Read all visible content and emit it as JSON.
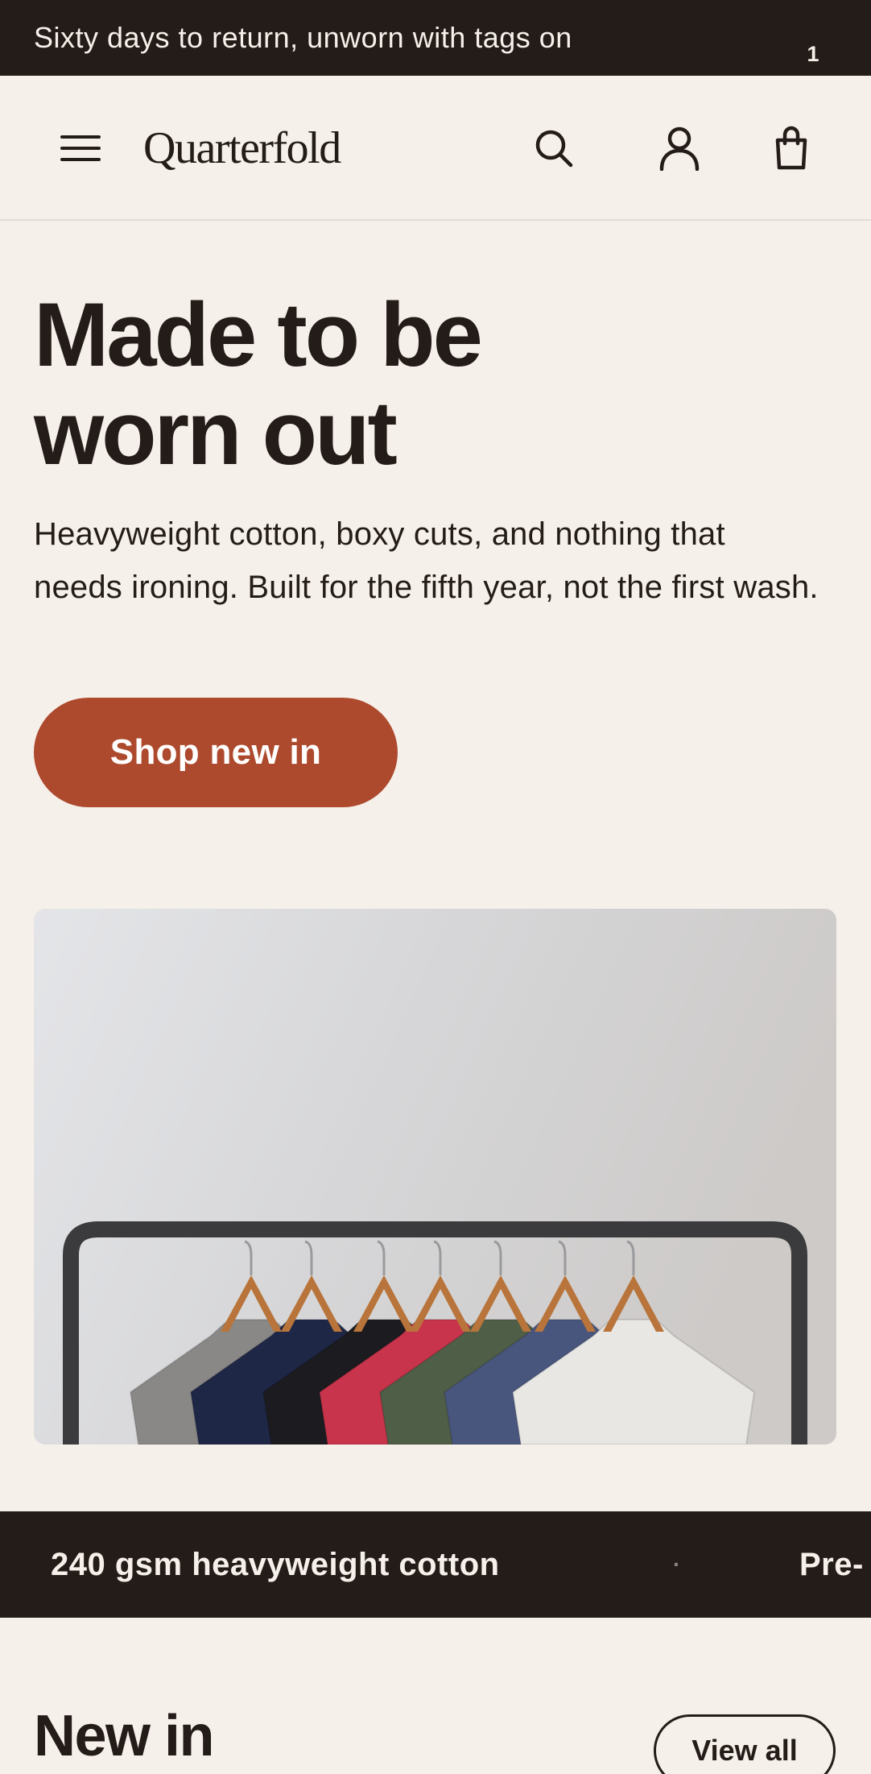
{
  "announcement": "Sixty days to return, unworn with tags on",
  "header": {
    "menu_icon": "menu-icon",
    "logo": "Quarterfold",
    "search_icon": "search-icon",
    "account_icon": "account-icon",
    "cart_icon": "bag-icon",
    "cart_count": "1"
  },
  "hero": {
    "title_line1": "Made to be",
    "title_line2": "worn out",
    "text": "Heavyweight cotton, boxy cuts, and nothing that needs ironing. Built for the fifth year, not the first wash.",
    "cta_label": "Shop new in"
  },
  "hero_image": {
    "subject": "clothing-rack-with-tshirts",
    "shirt_colors": [
      "#8a8887",
      "#1f2747",
      "#1c1b1f",
      "#c8344b",
      "#4f5e47",
      "#48567d",
      "#e8e7e4"
    ]
  },
  "feature_strip": {
    "item1": "240 gsm heavyweight cotton",
    "separator": "·",
    "item2": "Pre-"
  },
  "section": {
    "title": "New in",
    "view_all_label": "View all"
  },
  "colors": {
    "background": "#f6f0ea",
    "ink": "#241c18",
    "accent": "#ad4a2d"
  }
}
